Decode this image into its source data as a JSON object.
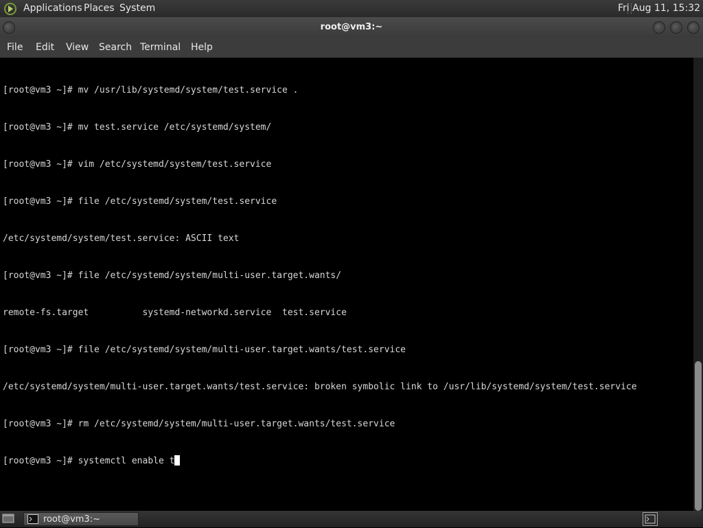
{
  "top_panel": {
    "menus": [
      "Applications",
      "Places",
      "System"
    ],
    "clock": "Fri Aug 11, 15:32",
    "logo_icon": "distro-logo-icon"
  },
  "window": {
    "title": "root@vm3:~",
    "controls": [
      "minimize-icon",
      "maximize-icon",
      "close-icon"
    ]
  },
  "menubar": [
    "File",
    "Edit",
    "View",
    "Search",
    "Terminal",
    "Help"
  ],
  "terminal": {
    "lines": [
      "[root@vm3 ~]# mv /usr/lib/systemd/system/test.service .",
      "[root@vm3 ~]# mv test.service /etc/systemd/system/",
      "[root@vm3 ~]# vim /etc/systemd/system/test.service",
      "[root@vm3 ~]# file /etc/systemd/system/test.service",
      "/etc/systemd/system/test.service: ASCII text",
      "[root@vm3 ~]# file /etc/systemd/system/multi-user.target.wants/",
      "remote-fs.target          systemd-networkd.service  test.service",
      "[root@vm3 ~]# file /etc/systemd/system/multi-user.target.wants/test.service",
      "/etc/systemd/system/multi-user.target.wants/test.service: broken symbolic link to /usr/lib/systemd/system/test.service",
      "[root@vm3 ~]# rm /etc/systemd/system/multi-user.target.wants/test.service"
    ],
    "current_input": "[root@vm3 ~]# systemctl enable t",
    "scroll_position": 1.0,
    "visible_fraction": 0.33
  },
  "taskbar": {
    "task_label": "root@vm3:~",
    "task_icon": "terminal-icon",
    "show_desktop_icon": "show-desktop-icon",
    "workspace_icon": "workspace-switcher-icon"
  },
  "colors": {
    "terminal_bg": "#000000",
    "terminal_fg": "#d8d8d8",
    "panel_bg": "#2f2f2f"
  }
}
